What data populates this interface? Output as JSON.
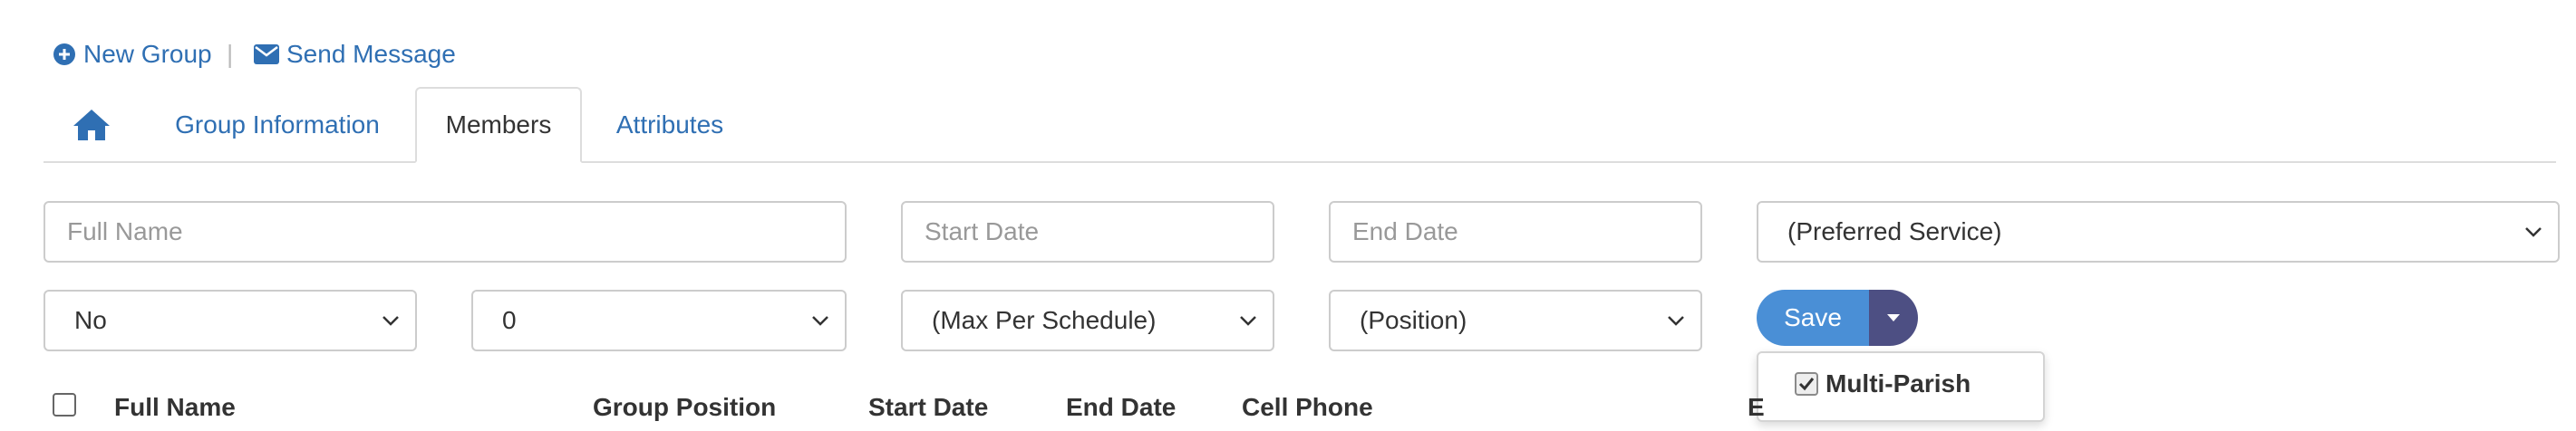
{
  "actions": {
    "new_group": "New Group",
    "separator": "|",
    "send_message": "Send Message"
  },
  "tabs": [
    {
      "label": "Group Information"
    },
    {
      "label": "Members",
      "active": true
    },
    {
      "label": "Attributes"
    }
  ],
  "filters": {
    "full_name_placeholder": "Full Name",
    "start_date_placeholder": "Start Date",
    "end_date_placeholder": "End Date",
    "preferred_service": "(Preferred Service)",
    "yes_no": "No",
    "count": "0",
    "max_per_schedule": "(Max Per Schedule)",
    "position": "(Position)"
  },
  "save": {
    "label": "Save",
    "menu_item": "Multi-Parish",
    "menu_item_checked": true
  },
  "table": {
    "columns": [
      "Full Name",
      "Group Position",
      "Start Date",
      "End Date",
      "Cell Phone",
      "E"
    ]
  },
  "colors": {
    "link": "#2f6fb3",
    "save": "#4a8fd6",
    "save_caret": "#4d4f83"
  },
  "icons": [
    "plus-circle-icon",
    "envelope-icon",
    "home-icon",
    "chevron-down-icon",
    "caret-down-icon",
    "checkbox-checked-icon",
    "checkbox-icon"
  ]
}
